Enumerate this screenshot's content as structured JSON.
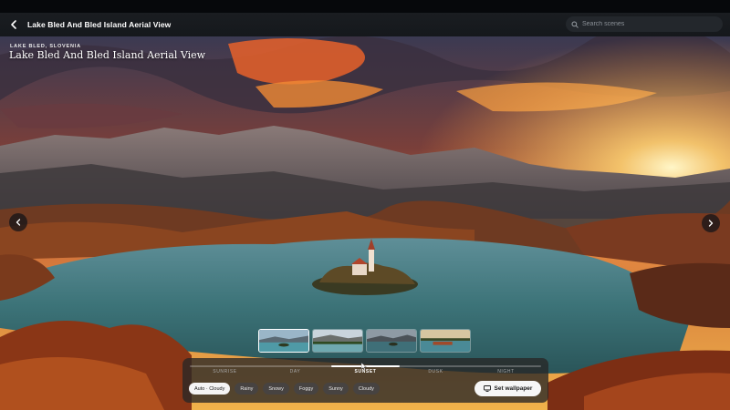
{
  "header": {
    "title": "Lake Bled And Bled Island Aerial View",
    "search_placeholder": "Search scenes"
  },
  "scene": {
    "location": "LAKE BLED, SLOVENIA",
    "title": "Lake Bled And Bled Island Aerial View"
  },
  "thumbnails": [
    {
      "label": "variant-1",
      "active": true
    },
    {
      "label": "variant-2",
      "active": false
    },
    {
      "label": "variant-3",
      "active": false
    },
    {
      "label": "variant-4",
      "active": false
    }
  ],
  "time_of_day": {
    "phases": [
      "SUNRISE",
      "DAY",
      "SUNSET",
      "DUSK",
      "NIGHT"
    ],
    "selected": "SUNSET"
  },
  "weather": {
    "options": [
      "Auto · Cloudy",
      "Rainy",
      "Snowy",
      "Foggy",
      "Sunny",
      "Cloudy"
    ],
    "selected": "Auto · Cloudy"
  },
  "actions": {
    "set_wallpaper": "Set wallpaper"
  },
  "icons": {
    "back": "chevron-left-icon",
    "search": "search-icon",
    "prev": "chevron-left-icon",
    "next": "chevron-right-icon",
    "wallpaper": "monitor-icon"
  }
}
